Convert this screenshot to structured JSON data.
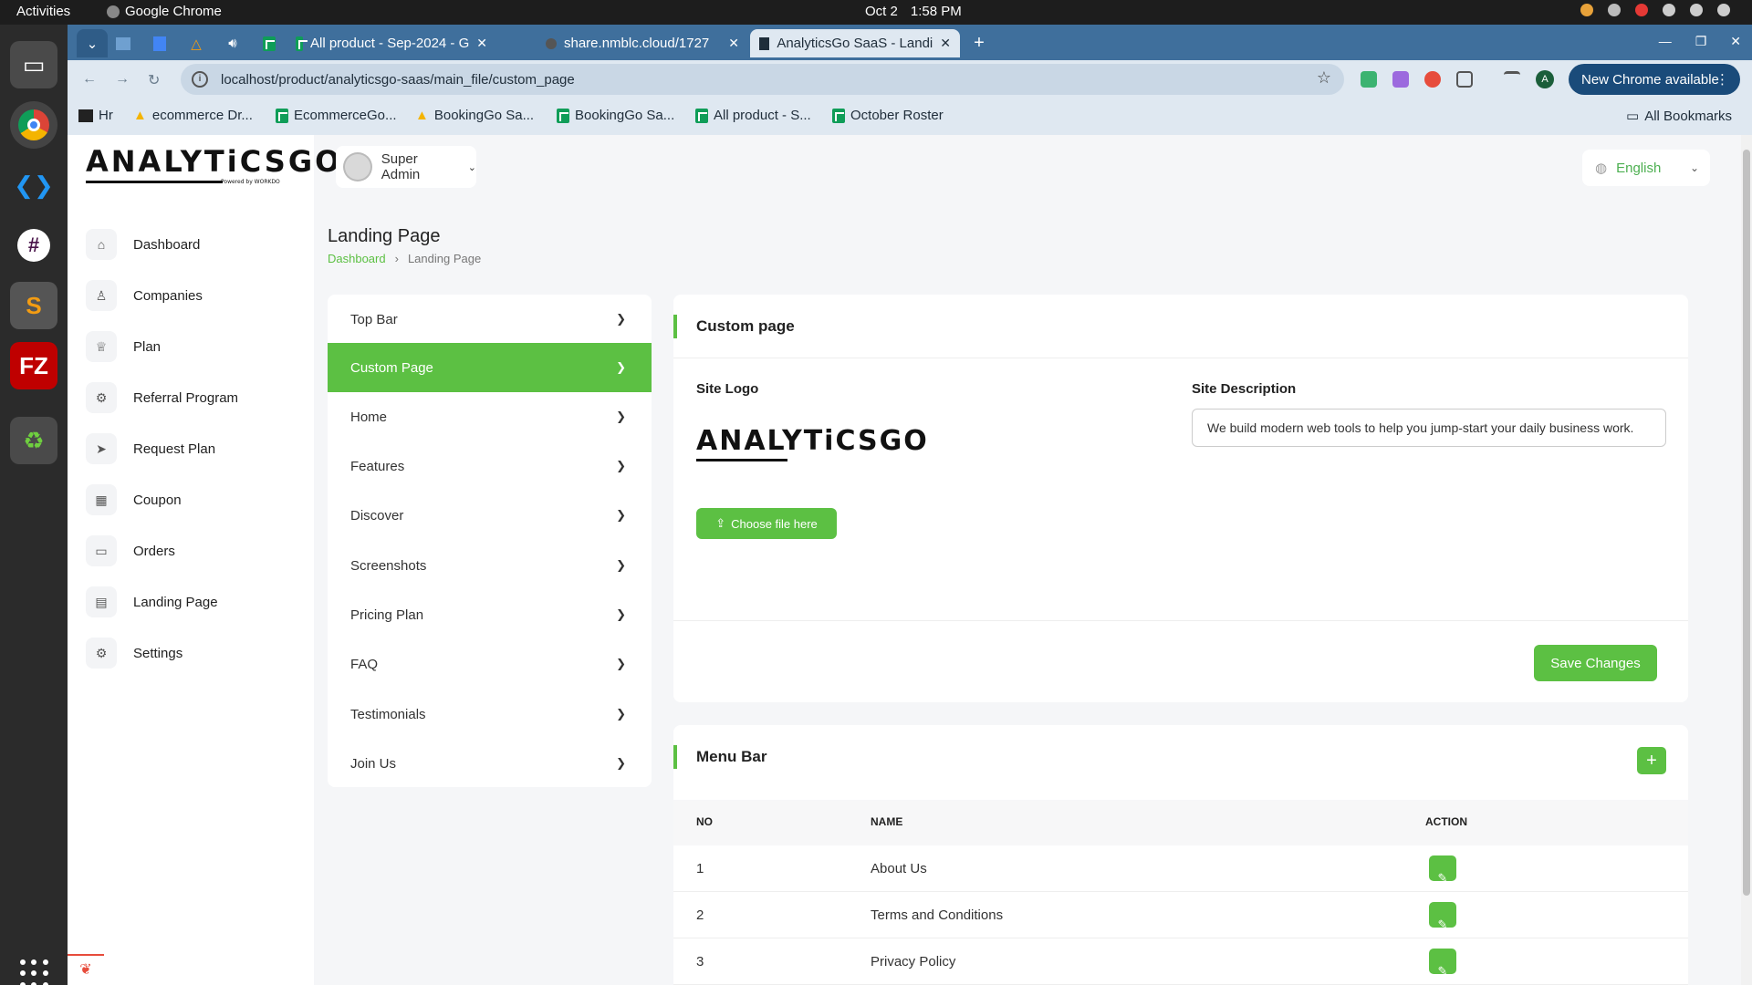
{
  "os": {
    "activities": "Activities",
    "app_name": "Google Chrome",
    "date": "Oct 2",
    "time": "1:58 PM"
  },
  "chrome": {
    "tabs": [
      {
        "title": "All product - Sep-2024 - G"
      },
      {
        "title": "share.nmblc.cloud/1727"
      },
      {
        "title": "AnalyticsGo SaaS - Landi"
      }
    ],
    "url": "localhost/product/analyticsgo-saas/main_file/custom_page",
    "new_chrome": "New Chrome available",
    "avatar_letter": "A",
    "bookmarks": [
      "Hr",
      "ecommerce Dr...",
      "EcommerceGo...",
      "BookingGo Sa...",
      "BookingGo Sa...",
      "All product - S...",
      "October Roster"
    ],
    "all_bookmarks": "All Bookmarks"
  },
  "app": {
    "logo_text": "ANALYTiCSGO",
    "logo_sub": "Powered by WORKDO",
    "user": "Super Admin",
    "language": "English",
    "sidebar": [
      {
        "label": "Dashboard",
        "icon": "home-icon"
      },
      {
        "label": "Companies",
        "icon": "user-icon"
      },
      {
        "label": "Plan",
        "icon": "trophy-icon"
      },
      {
        "label": "Referral Program",
        "icon": "referral-icon"
      },
      {
        "label": "Request Plan",
        "icon": "send-icon"
      },
      {
        "label": "Coupon",
        "icon": "gift-icon"
      },
      {
        "label": "Orders",
        "icon": "credit-card-icon"
      },
      {
        "label": "Landing Page",
        "icon": "clipboard-icon"
      },
      {
        "label": "Settings",
        "icon": "settings-icon"
      }
    ],
    "page_title": "Landing Page",
    "breadcrumb": {
      "home": "Dashboard",
      "current": "Landing Page"
    },
    "menu": [
      "Top Bar",
      "Custom Page",
      "Home",
      "Features",
      "Discover",
      "Screenshots",
      "Pricing Plan",
      "FAQ",
      "Testimonials",
      "Join Us"
    ],
    "menu_active": "Custom Page",
    "custom_page": {
      "title": "Custom page",
      "site_logo_label": "Site Logo",
      "site_description_label": "Site Description",
      "site_description_value": "We build modern web tools to help you jump-start your daily business work.",
      "choose_file": "Choose file here",
      "save": "Save Changes"
    },
    "menu_bar": {
      "title": "Menu Bar",
      "columns": [
        "NO",
        "NAME",
        "ACTION"
      ],
      "rows": [
        {
          "no": "1",
          "name": "About Us"
        },
        {
          "no": "2",
          "name": "Terms and Conditions"
        },
        {
          "no": "3",
          "name": "Privacy Policy"
        }
      ]
    }
  },
  "colors": {
    "accent": "#5cc043",
    "chrome_frame": "#3f6f9c"
  }
}
